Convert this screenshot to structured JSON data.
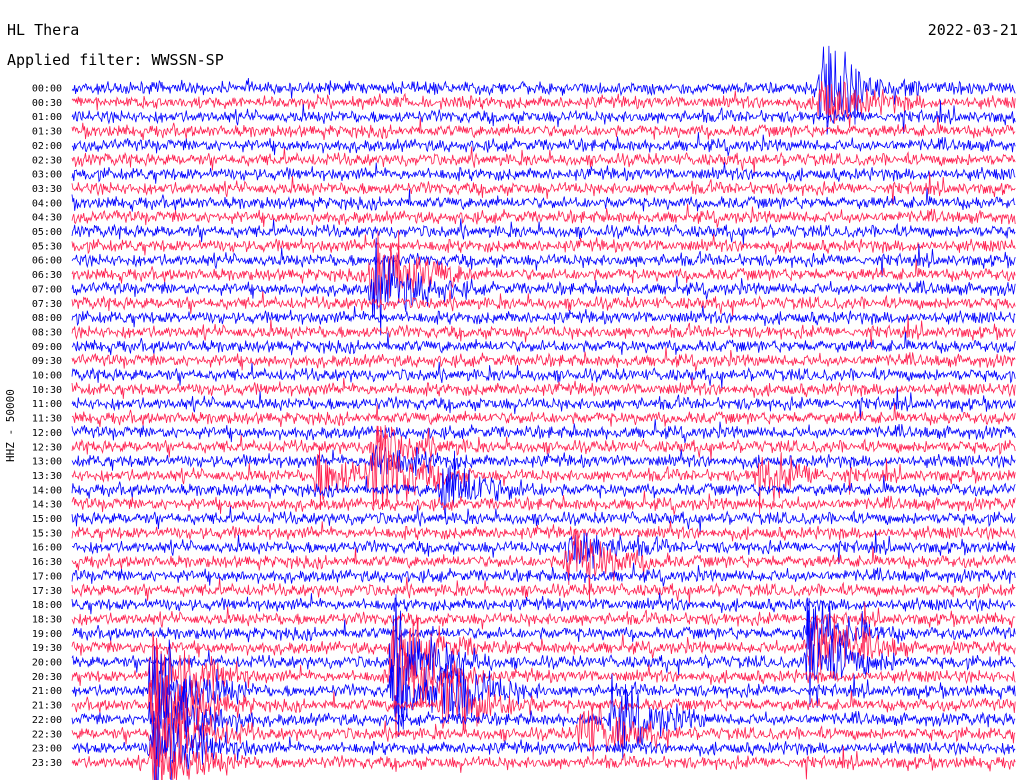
{
  "header": {
    "station": "HL Thera",
    "date": "2022-03-21",
    "filter_label": "Applied filter: WWSSN-SP"
  },
  "chart_data": {
    "type": "line",
    "title": "HL Thera",
    "ylabel": "HHZ - 50000",
    "row_labels": [
      "00:00",
      "00:30",
      "01:00",
      "01:30",
      "02:00",
      "02:30",
      "03:00",
      "03:30",
      "04:00",
      "04:30",
      "05:00",
      "05:30",
      "06:00",
      "06:30",
      "07:00",
      "07:30",
      "08:00",
      "08:30",
      "09:00",
      "09:30",
      "10:00",
      "10:30",
      "11:00",
      "11:30",
      "12:00",
      "12:30",
      "13:00",
      "13:30",
      "14:00",
      "14:30",
      "15:00",
      "15:30",
      "16:00",
      "16:30",
      "17:00",
      "17:30",
      "18:00",
      "18:30",
      "19:00",
      "19:30",
      "20:00",
      "20:30",
      "21:00",
      "21:30",
      "22:00",
      "22:30",
      "23:00",
      "23:30"
    ],
    "row_duration_minutes": 15,
    "series_colors": [
      "#0000ff",
      "#ff1f4f"
    ],
    "events": [
      {
        "row": 0,
        "minute": 11.9,
        "amplitude": 3.0
      },
      {
        "row": 1,
        "minute": 11.9,
        "amplitude": 1.6
      },
      {
        "row": 13,
        "minute": 4.8,
        "amplitude": 3.0
      },
      {
        "row": 14,
        "minute": 4.8,
        "amplitude": 2.2
      },
      {
        "row": 25,
        "minute": 4.8,
        "amplitude": 1.3
      },
      {
        "row": 26,
        "minute": 4.8,
        "amplitude": 1.1
      },
      {
        "row": 27,
        "minute": 4.8,
        "amplitude": 2.2
      },
      {
        "row": 28,
        "minute": 5.9,
        "amplitude": 1.8
      },
      {
        "row": 27,
        "minute": 3.9,
        "amplitude": 1.5
      },
      {
        "row": 27,
        "minute": 10.9,
        "amplitude": 1.3
      },
      {
        "row": 32,
        "minute": 7.9,
        "amplitude": 1.3
      },
      {
        "row": 33,
        "minute": 7.9,
        "amplitude": 2.0
      },
      {
        "row": 38,
        "minute": 11.7,
        "amplitude": 1.7
      },
      {
        "row": 39,
        "minute": 11.7,
        "amplitude": 2.6
      },
      {
        "row": 40,
        "minute": 11.7,
        "amplitude": 2.2
      },
      {
        "row": 39,
        "minute": 5.1,
        "amplitude": 2.0
      },
      {
        "row": 40,
        "minute": 5.1,
        "amplitude": 3.0
      },
      {
        "row": 41,
        "minute": 5.1,
        "amplitude": 2.6
      },
      {
        "row": 42,
        "minute": 5.1,
        "amplitude": 1.8
      },
      {
        "row": 42,
        "minute": 5.9,
        "amplitude": 2.0
      },
      {
        "row": 43,
        "minute": 5.9,
        "amplitude": 2.4
      },
      {
        "row": 44,
        "minute": 8.6,
        "amplitude": 2.0
      },
      {
        "row": 45,
        "minute": 8.1,
        "amplitude": 1.8
      },
      {
        "row": 41,
        "minute": 1.3,
        "amplitude": 3.0
      },
      {
        "row": 42,
        "minute": 1.3,
        "amplitude": 3.0
      },
      {
        "row": 43,
        "minute": 1.3,
        "amplitude": 3.0
      },
      {
        "row": 44,
        "minute": 1.3,
        "amplitude": 3.0
      },
      {
        "row": 45,
        "minute": 1.3,
        "amplitude": 3.0
      },
      {
        "row": 46,
        "minute": 1.3,
        "amplitude": 2.6
      },
      {
        "row": 47,
        "minute": 1.3,
        "amplitude": 2.0
      }
    ]
  }
}
